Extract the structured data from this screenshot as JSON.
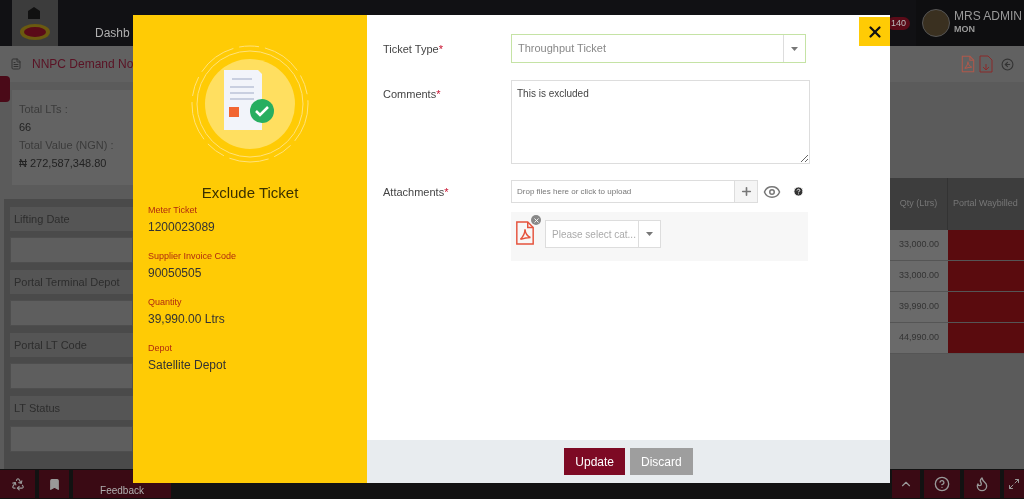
{
  "top_nav": {
    "items": [
      {
        "label": "Dashb"
      }
    ],
    "notification_count": "140",
    "user": {
      "name": "MRS ADMIN",
      "role": "MON"
    }
  },
  "page_header": {
    "title": "NNPC Demand No"
  },
  "summary": {
    "fields": [
      {
        "label": "Total LTs :",
        "value": "66"
      },
      {
        "label": "Total Value (NGN) :",
        "value": "₦ 272,587,348.80"
      }
    ]
  },
  "filters": [
    {
      "label": "Lifting Date"
    },
    {
      "label": "Portal Terminal Depot"
    },
    {
      "label": "Portal LT Code"
    },
    {
      "label": "LT Status"
    }
  ],
  "table": {
    "columns": [
      "Qty (Ltrs)",
      "Portal Waybilled"
    ],
    "rows": [
      {
        "qty": "33,000.00"
      },
      {
        "qty": "33,000.00"
      },
      {
        "qty": "39,990.00"
      },
      {
        "qty": "44,990.00"
      }
    ]
  },
  "bottom_bar": {
    "feedback": "Feedback"
  },
  "dialog": {
    "title": "Exclude Ticket",
    "details": [
      {
        "label": "Meter Ticket",
        "value": "1200023089"
      },
      {
        "label": "Supplier Invoice Code",
        "value": "90050505"
      },
      {
        "label": "Quantity",
        "value": "39,990.00 Ltrs"
      },
      {
        "label": "Depot",
        "value": "Satellite Depot"
      }
    ],
    "form": {
      "ticket_type": {
        "label": "Ticket Type",
        "required_mark": "*",
        "value": "Throughput Ticket"
      },
      "comments": {
        "label": "Comments",
        "required_mark": "*",
        "value": "This is excluded"
      },
      "attachments": {
        "label": "Attachments",
        "required_mark": "*",
        "placeholder": "Drop files here or click to upload",
        "files": [
          {
            "category_placeholder": "Please select cat..."
          }
        ]
      }
    },
    "buttons": [
      {
        "label": "Update",
        "kind": "primary"
      },
      {
        "label": "Discard",
        "kind": "secondary"
      }
    ]
  }
}
